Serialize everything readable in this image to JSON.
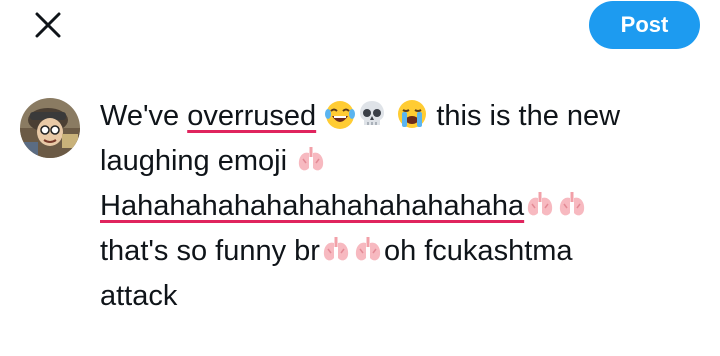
{
  "toolbar": {
    "close_icon": "close-icon",
    "post_label": "Post",
    "post_color": "#1d9bf0"
  },
  "composer": {
    "avatar_icon": "avatar",
    "text_lines": [
      {
        "seg1": "We've ",
        "misspelled": "overrused",
        "emojis": [
          "laughing-emoji",
          "skull-emoji",
          "crying-emoji"
        ],
        "seg2": " this is the new"
      },
      {
        "seg1": "laughing emoji ",
        "emojis": [
          "lungs-emoji"
        ]
      },
      {
        "misspelled": "Hahahahahahahahahahahahaha",
        "emojis": [
          "lungs-emoji",
          "lungs-emoji"
        ]
      },
      {
        "seg1": "that's so funny br",
        "emojis": [
          "lungs-emoji",
          "lungs-emoji"
        ],
        "seg2": "oh fcukashtma"
      },
      {
        "seg1": "attack"
      }
    ],
    "underline_color": "#e0245e"
  }
}
